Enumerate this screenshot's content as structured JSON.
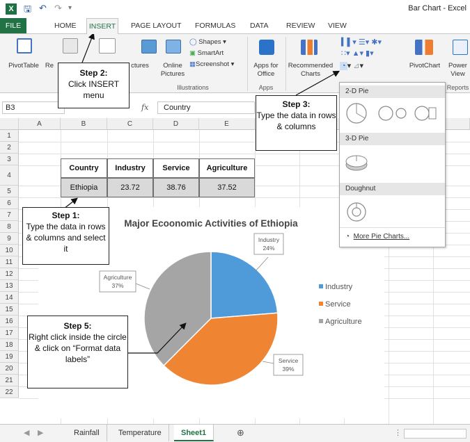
{
  "window": {
    "title": "Bar Chart - Excel"
  },
  "tabs": {
    "file": "FILE",
    "items": [
      "HOME",
      "INSERT",
      "PAGE LAYOUT",
      "FORMULAS",
      "DATA",
      "REVIEW",
      "VIEW"
    ],
    "active": "INSERT"
  },
  "ribbon": {
    "pivot_table": "PivotTable",
    "recommended_pivot_trunc": "Re",
    "pictures_trunc": "ctures",
    "online_pictures": "Online\nPictures",
    "shapes": "Shapes",
    "smartart": "SmartArt",
    "screenshot": "Screenshot",
    "illustrations": "Illustrations",
    "apps_for_office": "Apps for\nOffice",
    "apps": "Apps",
    "recommended_charts": "Recommended\nCharts",
    "pivot_chart": "PivotChart",
    "power_view": "Power\nView",
    "reports_trunc": "Reports"
  },
  "formula_bar": {
    "name_box": "B3",
    "fx": "fx",
    "content": "Country"
  },
  "columns": [
    "A",
    "B",
    "C",
    "D",
    "E"
  ],
  "rows": [
    "1",
    "2",
    "3",
    "4",
    "5",
    "6",
    "7",
    "8",
    "9",
    "10",
    "11",
    "12",
    "13",
    "14",
    "15",
    "16",
    "17",
    "18",
    "19",
    "20",
    "21",
    "22"
  ],
  "table": {
    "headers": [
      "Country",
      "Industry",
      "Service",
      "Agriculture"
    ],
    "row": [
      "Ethiopia",
      "23.72",
      "38.76",
      "37.52"
    ]
  },
  "chart_data": {
    "type": "pie",
    "title": "Major Ecoonomic Activities of Ethiopia",
    "categories": [
      "Industry",
      "Service",
      "Agriculture"
    ],
    "values": [
      23.72,
      38.76,
      37.52
    ],
    "data_labels": [
      {
        "name": "Industry",
        "pct": "24%"
      },
      {
        "name": "Service",
        "pct": "39%"
      },
      {
        "name": "Agriculture",
        "pct": "37%"
      }
    ],
    "colors": [
      "#4f9ad9",
      "#ef8432",
      "#a5a5a5"
    ],
    "legend": [
      "Industry",
      "Service",
      "Agriculture"
    ],
    "legend_position": "right"
  },
  "pie_menu": {
    "sections": [
      "2-D Pie",
      "3-D Pie",
      "Doughnut"
    ],
    "more": "More Pie Charts..."
  },
  "callouts": {
    "step1": {
      "title": "Step 1:",
      "text": "Type the data in rows & columns and select it"
    },
    "step2": {
      "title": "Step 2:",
      "text": "Click INSERT menu"
    },
    "step3": {
      "title": "Step 3:",
      "text": "Type the data in rows & columns"
    },
    "step5": {
      "title": "Step 5:",
      "text": "Right click inside the circle & click on “Format data labels”"
    }
  },
  "sheets": {
    "items": [
      "Rainfall",
      "Temperature",
      "Sheet1"
    ],
    "active": "Sheet1"
  }
}
